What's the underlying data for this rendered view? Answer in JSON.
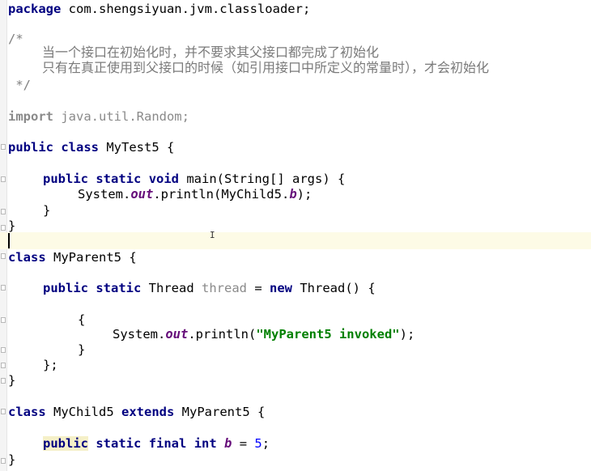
{
  "editor": {
    "lines": {
      "package": "package",
      "package_name": " com.shengsiyuan.jvm.classloader;",
      "comment_open": "/*",
      "comment_line1": "当一个接口在初始化时，并不要求其父接口都完成了初始化",
      "comment_line2": "只有在真正使用到父接口的时候（如引用接口中所定义的常量时），才会初始化",
      "comment_close": " */",
      "import_kw": "import",
      "import_name": " java.util.Random;",
      "public": "public",
      "class": "class",
      "mytest5": " MyTest5 {",
      "static": "static",
      "void": "void",
      "main_sig": " main(String[] args) {",
      "system_out": "System.",
      "out": "out",
      "println_b_pre": ".println(MyChild5.",
      "b": "b",
      "println_b_post": ");",
      "close_brace": "}",
      "close_brace_semi": "};",
      "open_brace": "{",
      "myparent5_decl": " MyParent5 {",
      "thread_type": " Thread ",
      "thread_field": "thread",
      "assign": " = ",
      "new": "new",
      "thread_ctor": " Thread() {",
      "println_open": ".println(",
      "invoked_str": "\"MyParent5 invoked\"",
      "println_close": ");",
      "mychild5_name": " MyChild5 ",
      "extends": "extends",
      "myparent5_ref": " MyParent5 {",
      "final": "final",
      "int": "int",
      "b_assign": " = ",
      "five": "5",
      "semi": ";"
    },
    "colors": {
      "keyword": "#000080",
      "static_field": "#660e7a",
      "string": "#008000",
      "number": "#0000ff",
      "comment": "#808080",
      "caret_line": "#fdfbe6"
    },
    "cursor_icon": "text-cursor-icon"
  }
}
